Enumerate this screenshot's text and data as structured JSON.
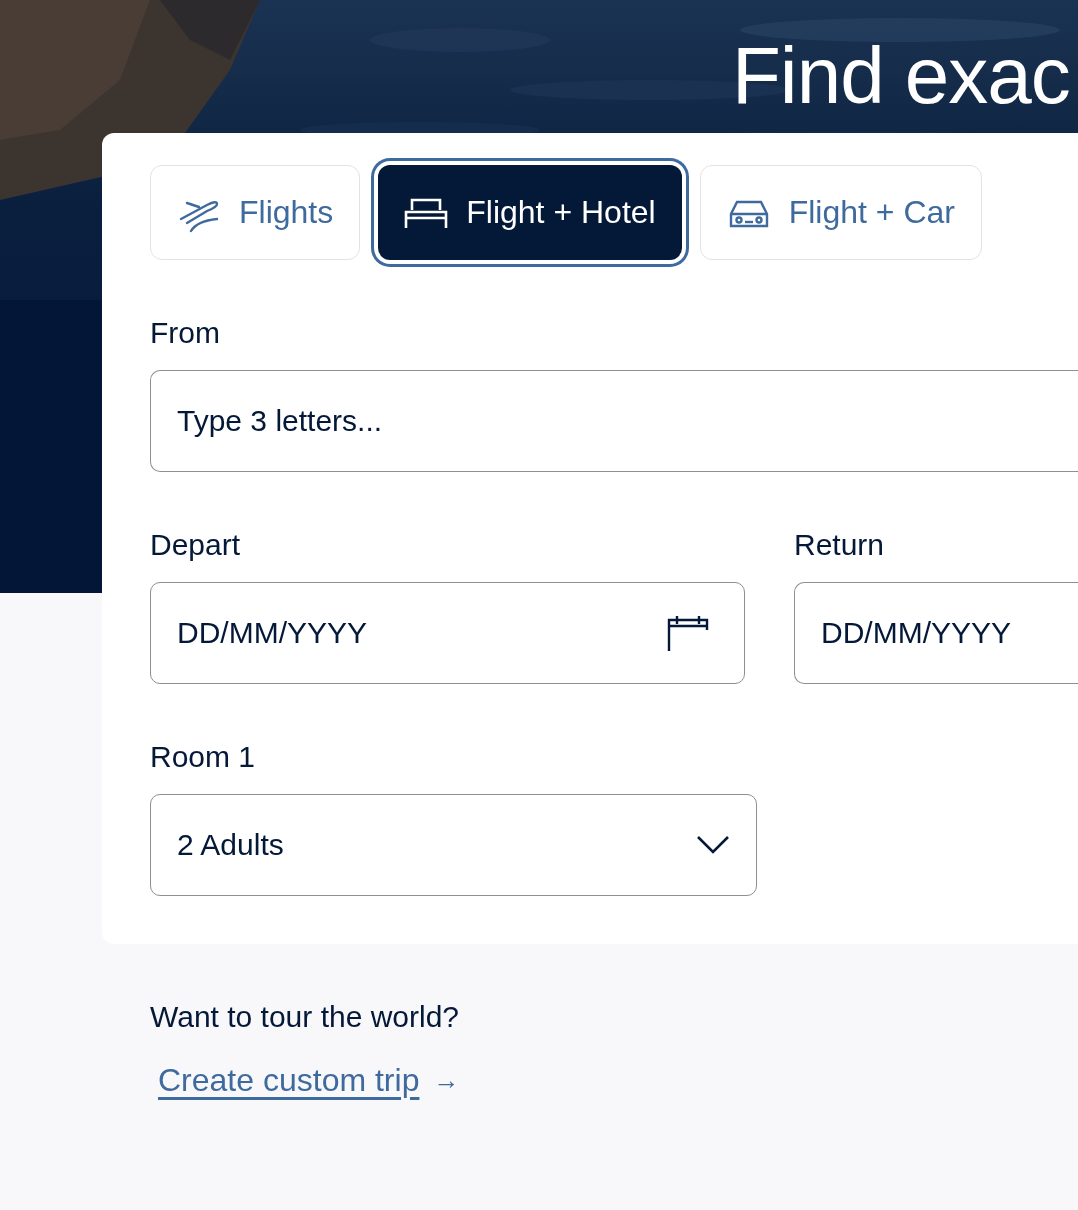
{
  "hero": {
    "title": "Find exac"
  },
  "tabs": [
    {
      "label": "Flights",
      "kind": "flights",
      "selected": false
    },
    {
      "label": "Flight + Hotel",
      "kind": "hotel",
      "selected": true
    },
    {
      "label": "Flight + Car",
      "kind": "car",
      "selected": false
    }
  ],
  "from": {
    "label": "From",
    "placeholder": "Type 3 letters..."
  },
  "depart": {
    "label": "Depart",
    "placeholder": "DD/MM/YYYY"
  },
  "return": {
    "label": "Return",
    "placeholder": "DD/MM/YYYY"
  },
  "room": {
    "label": "Room 1",
    "value": "2 Adults"
  },
  "promo": {
    "text": "Want to tour the world?",
    "link": "Create custom trip",
    "arrow": "→"
  }
}
